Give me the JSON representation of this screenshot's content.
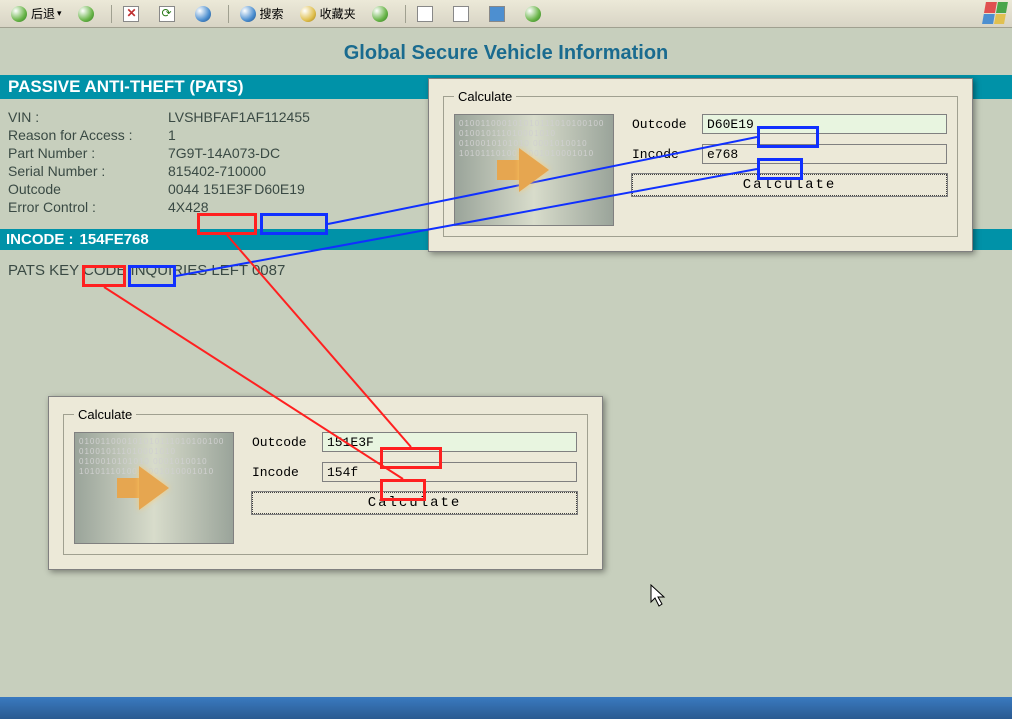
{
  "toolbar": {
    "back_label": "后退",
    "search_label": "搜索",
    "favorites_label": "收藏夹"
  },
  "page_title": "Global Secure Vehicle Information",
  "section_title": "PASSIVE ANTI-THEFT (PATS)",
  "info": {
    "vin_label": "VIN :",
    "vin_value": "LVSHBFAF1AF112455",
    "reason_label": "Reason for Access :",
    "reason_value": "1",
    "partnum_label": "Part Number :",
    "partnum_value": "7G9T-14A073-DC",
    "serial_label": "Serial Number :",
    "serial_value": "815402-710000",
    "outcode_label": "Outcode",
    "outcode_prefix": "0044",
    "outcode_seg1": "151E3F",
    "outcode_seg2": "D60E19",
    "error_label": "Error Control :",
    "error_value": "4X428"
  },
  "incode": {
    "label": "INCODE :",
    "seg1": "154F",
    "seg2": "E768"
  },
  "key_inq_prefix": "PATS KEY CODE INQUIRIES LEFT ",
  "key_inq_value": "0087",
  "calc": {
    "legend": "Calculate",
    "outcode_label": "Outcode",
    "incode_label": "Incode",
    "button": "Calculate",
    "bits": "010011000101010111010100100\n010010111010001010\n0100010101010\n0001010010\n1010111010010001010001010"
  },
  "dialog_top": {
    "outcode_value": "D60E19",
    "incode_value": "e768"
  },
  "dialog_bottom": {
    "outcode_value": "151E3F",
    "incode_value": "154f"
  }
}
